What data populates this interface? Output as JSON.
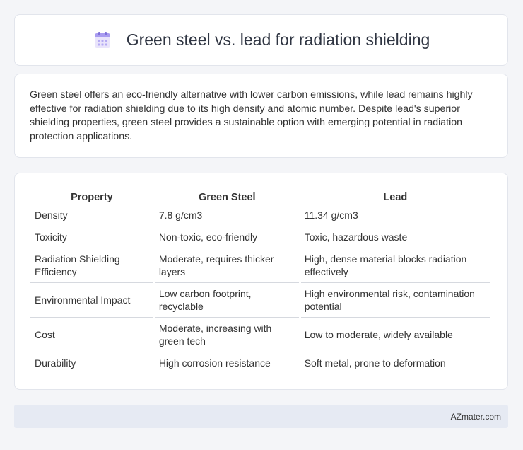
{
  "header": {
    "title": "Green steel vs. lead for radiation shielding",
    "icon": "calendar-icon"
  },
  "summary": {
    "text": "Green steel offers an eco-friendly alternative with lower carbon emissions, while lead remains highly effective for radiation shielding due to its high density and atomic number. Despite lead's superior shielding properties, green steel provides a sustainable option with emerging potential in radiation protection applications."
  },
  "table": {
    "headers": [
      "Property",
      "Green Steel",
      "Lead"
    ],
    "rows": [
      [
        "Density",
        "7.8 g/cm3",
        "11.34 g/cm3"
      ],
      [
        "Toxicity",
        "Non-toxic, eco-friendly",
        "Toxic, hazardous waste"
      ],
      [
        "Radiation Shielding Efficiency",
        "Moderate, requires thicker layers",
        "High, dense material blocks radiation effectively"
      ],
      [
        "Environmental Impact",
        "Low carbon footprint, recyclable",
        "High environmental risk, contamination potential"
      ],
      [
        "Cost",
        "Moderate, increasing with green tech",
        "Low to moderate, widely available"
      ],
      [
        "Durability",
        "High corrosion resistance",
        "Soft metal, prone to deformation"
      ]
    ]
  },
  "footer": {
    "brand": "AZmater.com"
  }
}
